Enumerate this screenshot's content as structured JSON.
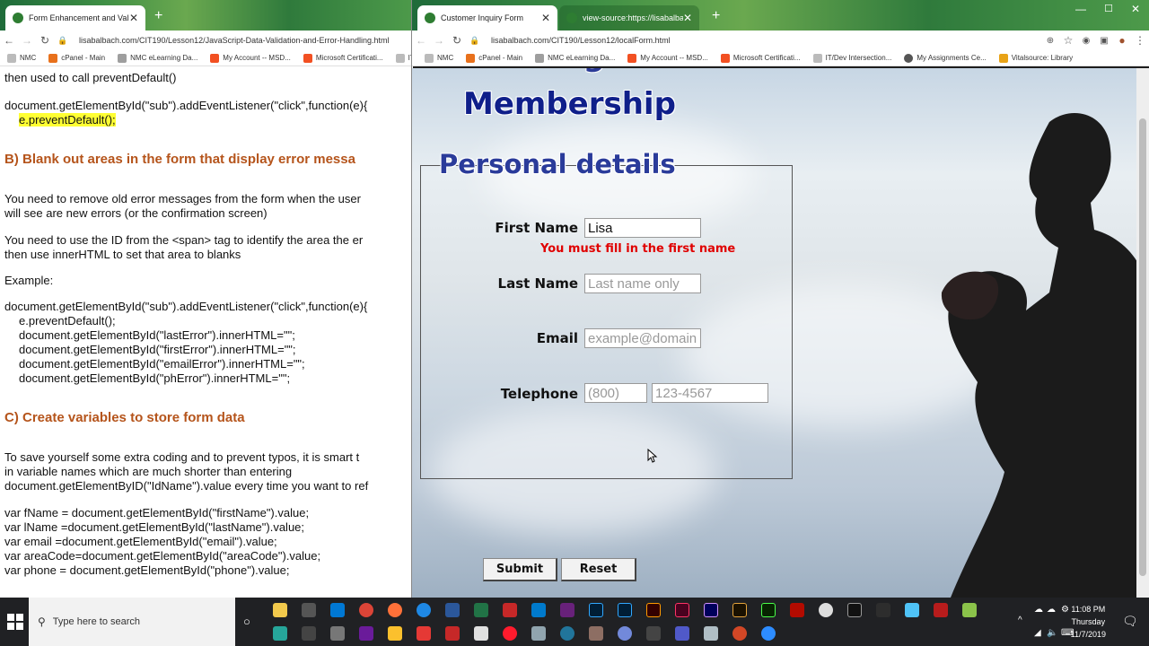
{
  "left_window": {
    "tabs": [
      {
        "title": "Form Enhancement and Validatio",
        "active": true
      }
    ],
    "url": "lisabalbach.com/CIT190/Lesson12/JavaScript-Data-Validation-and-Error-Handling.html",
    "bookmarks": [
      "NMC",
      "cPanel - Main",
      "NMC eLearning Da...",
      "My Account -- MSD...",
      "Microsoft Certificati...",
      "IT"
    ],
    "doc_lines": {
      "l1": "then used to call preventDefault()",
      "l2": "document.getElementById(\"sub\").addEventListener(\"click\",function(e){",
      "l3": "e.preventDefault();",
      "h_b": "B)  Blank out areas in the form that display error messa",
      "p1a": "You need to remove old error messages from the form when the user",
      "p1b": "will see are new errors (or the confirmation screen)",
      "p2a": "You need to use the ID from the <span> tag to identify the area the er",
      "p2b": "then use innerHTML to set that area to blanks",
      "ex": "Example:",
      "c1": "document.getElementById(\"sub\").addEventListener(\"click\",function(e){",
      "c2": "e.preventDefault();",
      "c3": "document.getElementById(\"lastError\").innerHTML=\"\";",
      "c4": "document.getElementById(\"firstError\").innerHTML=\"\";",
      "c5": "document.getElementById(\"emailError\").innerHTML=\"\";",
      "c6": "document.getElementById(\"phError\").innerHTML=\"\";",
      "h_c": "C)   Create variables to store form data",
      "p3a": "To save yourself some extra coding and to prevent typos, it is smart t",
      "p3b": "in variable names which are much shorter than entering",
      "p3c": "document.getElementByID(\"IdName\").value  every time you want to ref",
      "v1": "var fName = document.getElementById(\"firstName\").value;",
      "v2": "var lName =document.getElementById(\"lastName\").value;",
      "v3": "var email =document.getElementById(\"email\").value;",
      "v4": "var areaCode=document.getElementById(\"areaCode\").value;",
      "v5": "var phone = document.getElementById(\"phone\").value;"
    }
  },
  "right_window": {
    "tabs": [
      {
        "title": "Customer Inquiry Form",
        "active": true
      },
      {
        "title": "view-source:https://lisabalbach.c",
        "active": false
      }
    ],
    "url": "lisabalbach.com/CIT190/Lesson12/localForm.html",
    "bookmarks": [
      "NMC",
      "cPanel - Main",
      "NMC eLearning Da...",
      "My Account -- MSD...",
      "Microsoft Certificati...",
      "IT/Dev Intersection...",
      "My Assignments Ce...",
      "Vitalsource: Library"
    ],
    "page": {
      "title_line2": "Membership",
      "legend": "Personal details",
      "first_name_label": "First Name",
      "first_name_value": "Lisa",
      "first_error": "You must fill in the first name",
      "last_name_label": "Last Name",
      "last_name_placeholder": "Last name only",
      "email_label": "Email",
      "email_placeholder": "example@domain",
      "telephone_label": "Telephone",
      "area_placeholder": "(800)",
      "phone_placeholder": "123-4567",
      "submit_label": "Submit",
      "reset_label": "Reset"
    }
  },
  "taskbar": {
    "search_placeholder": "Type here to search",
    "time": "11:08 PM",
    "day": "Thursday",
    "date": "11/7/2019"
  }
}
